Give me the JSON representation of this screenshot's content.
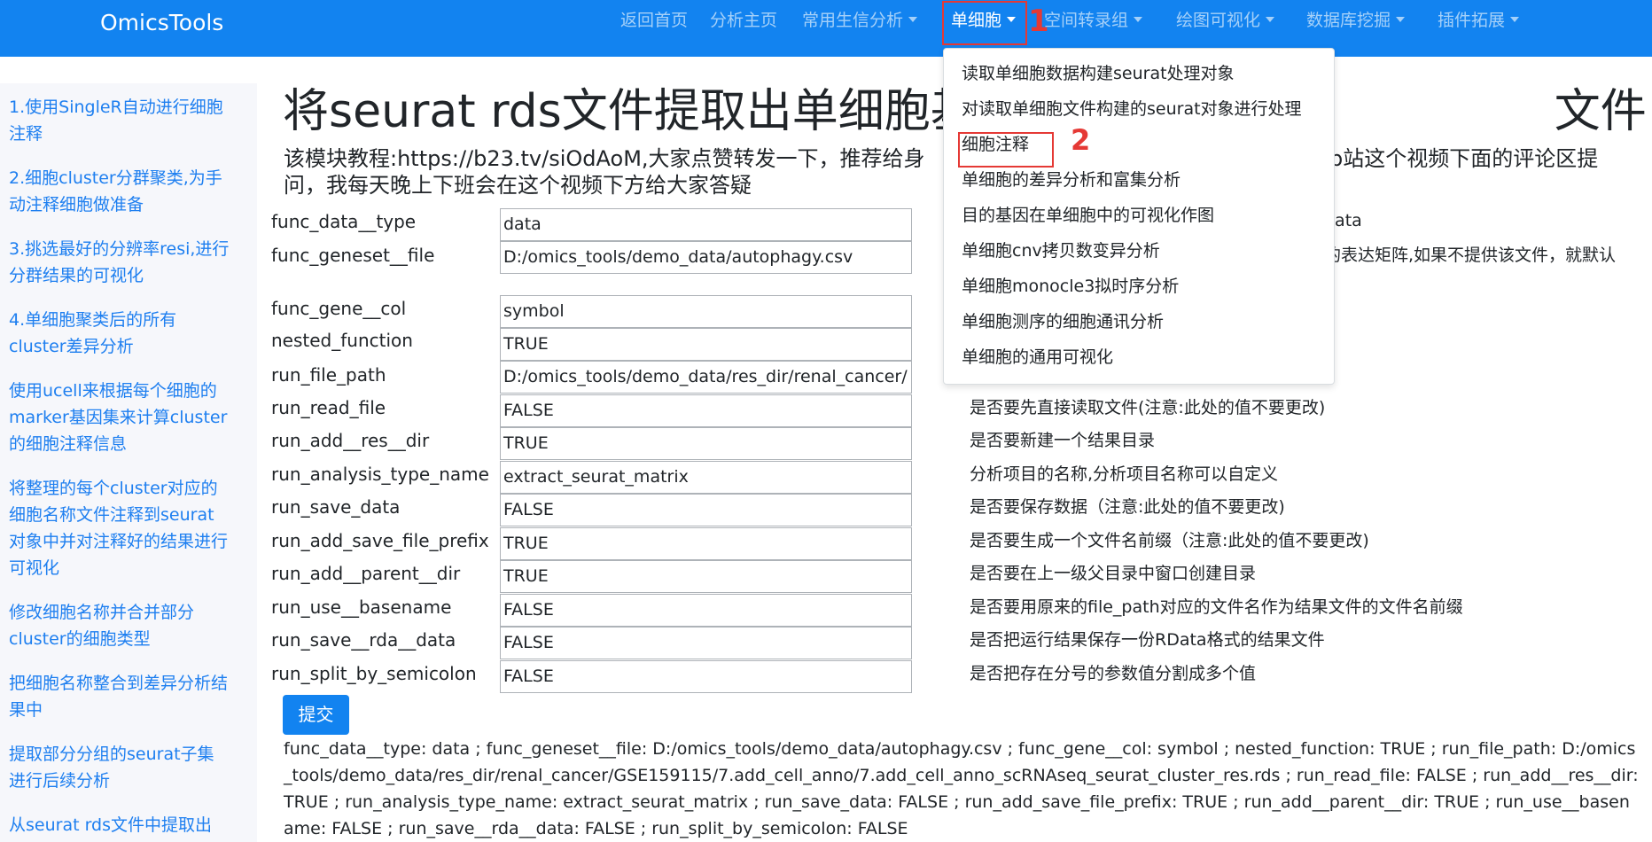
{
  "navbar": {
    "brand": "OmicsTools",
    "items": [
      {
        "label": "返回首页"
      },
      {
        "label": "分析主页"
      },
      {
        "label": "常用生信分析"
      },
      {
        "label": "单细胞"
      },
      {
        "label": "空间转录组"
      },
      {
        "label": "绘图可视化"
      },
      {
        "label": "数据库挖掘"
      },
      {
        "label": "插件拓展"
      }
    ]
  },
  "annotations": {
    "one": "1",
    "two": "2"
  },
  "sidebar": {
    "items": [
      {
        "label": "1.使用SingleR自动进行细胞注释"
      },
      {
        "label": "2.细胞cluster分群聚类,为手动注释细胞做准备"
      },
      {
        "label": "3.挑选最好的分辨率resi,进行分群结果的可视化"
      },
      {
        "label": "4.单细胞聚类后的所有cluster差异分析"
      },
      {
        "label": "使用ucell来根据每个细胞的marker基因集来计算cluster的细胞注释信息"
      },
      {
        "label": "将整理的每个cluster对应的细胞名称文件注释到seurat对象中并对注释好的结果进行可视化"
      },
      {
        "label": "修改细胞名称并合并部分cluster的细胞类型"
      },
      {
        "label": "把细胞名称整合到差异分析结果中"
      },
      {
        "label": "提取部分分组的seurat子集进行后续分析"
      },
      {
        "label": "从seurat rds文件中提取出"
      }
    ]
  },
  "main": {
    "title_left": "将seurat rds文件提取出单细胞基因",
    "title_right": "文件",
    "tutorial_left": "该模块教程:https://b23.tv/siOdAoM,大家点赞转发一下，推荐给身",
    "tutorial_right": "在b站这个视频下面的评论区提",
    "tutorial_line2": "问，我每天晚上下班会在这个视频下方给大家答疑",
    "fields": [
      {
        "label": "func_data__type",
        "value": "data",
        "desc": "data"
      },
      {
        "label": "func_geneset__file",
        "value": "D:/omics_tools/demo_data/autophagy.csv",
        "desc": "的表达矩阵,如果不提供该文件，就默认"
      },
      {
        "label": "func_gene__col",
        "value": "symbol",
        "desc": ""
      },
      {
        "label": "nested_function",
        "value": "TRUE",
        "desc": ""
      },
      {
        "label": "run_file_path",
        "value": "D:/omics_tools/demo_data/res_dir/renal_cancer/",
        "desc": ""
      },
      {
        "label": "run_read_file",
        "value": "FALSE",
        "desc": "是否要先直接读取文件(注意:此处的值不要更改)"
      },
      {
        "label": "run_add__res__dir",
        "value": "TRUE",
        "desc": "是否要新建一个结果目录"
      },
      {
        "label": "run_analysis_type_name",
        "value": "extract_seurat_matrix",
        "desc": "分析项目的名称,分析项目名称可以自定义"
      },
      {
        "label": "run_save_data",
        "value": "FALSE",
        "desc": "是否要保存数据（注意:此处的值不要更改)"
      },
      {
        "label": "run_add_save_file_prefix",
        "value": "TRUE",
        "desc": "是否要生成一个文件名前缀（注意:此处的值不要更改)"
      },
      {
        "label": "run_add__parent__dir",
        "value": "TRUE",
        "desc": "是否要在上一级父目录中窗口创建目录"
      },
      {
        "label": "run_use__basename",
        "value": "FALSE",
        "desc": "是否要用原来的file_path对应的文件名作为结果文件的文件名前缀"
      },
      {
        "label": "run_save__rda__data",
        "value": "FALSE",
        "desc": "是否把运行结果保存一份RData格式的结果文件"
      },
      {
        "label": "run_split_by_semicolon",
        "value": "FALSE",
        "desc": "是否把存在分号的参数值分割成多个值"
      }
    ],
    "submit_label": "提交",
    "result_text": "func_data__type: data ; func_geneset__file: D:/omics_tools/demo_data/autophagy.csv ; func_gene__col: symbol ; nested_function: TRUE ; run_file_path: D:/omics_tools/demo_data/res_dir/renal_cancer/GSE159115/7.add_cell_anno/7.add_cell_anno_scRNAseq_seurat_cluster_res.rds ; run_read_file: FALSE ; run_add__res__dir: TRUE ; run_analysis_type_name: extract_seurat_matrix ; run_save_data: FALSE ; run_add_save_file_prefix: TRUE ; run_add__parent__dir: TRUE ; run_use__basename: FALSE ; run_save__rda__data: FALSE ; run_split_by_semicolon: FALSE"
  },
  "dropdown": {
    "items": [
      {
        "label": "读取单细胞数据构建seurat处理对象"
      },
      {
        "label": "对读取单细胞文件构建的seurat对象进行处理"
      },
      {
        "label": "细胞注释"
      },
      {
        "label": "单细胞的差异分析和富集分析"
      },
      {
        "label": "目的基因在单细胞中的可视化作图"
      },
      {
        "label": "单细胞cnv拷贝数变异分析"
      },
      {
        "label": "单细胞monocle3拟时序分析"
      },
      {
        "label": "单细胞测序的细胞通讯分析"
      },
      {
        "label": "单细胞的通用可视化"
      }
    ]
  },
  "colors": {
    "navbar": "#1283f0",
    "link": "#1e7ff0",
    "annotation": "#e53935",
    "sidebar_bg": "#f6f7fb"
  }
}
